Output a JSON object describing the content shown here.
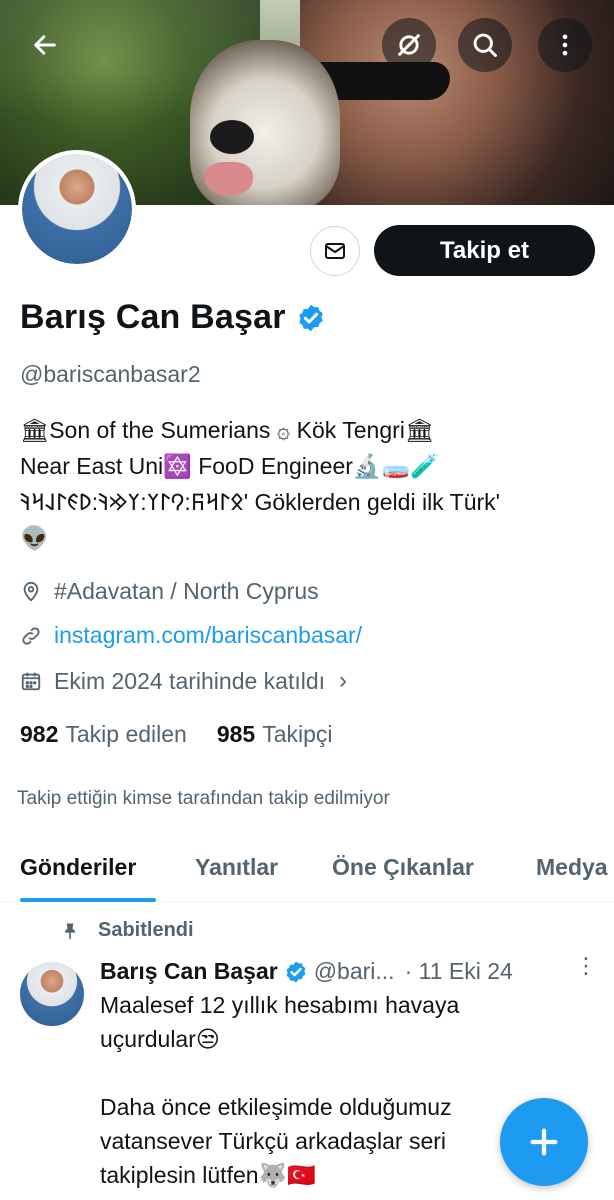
{
  "profile": {
    "name": "Barış Can Başar",
    "handle": "@bariscanbasar2",
    "follow_label": "Takip et",
    "bio": [
      "🏛Son of the Sumerians ۞ Kök Tengri🏛",
      "Near East Uni🔯 FooD Engineer🔬🧫🧪",
      "𐰋𐰃𐰺𐰜:𐰘𐰃𐰠:𐰠𐰢𐰚:𐰖𐰏𐰃𐰞𐰺𐰚' Göklerden geldi ilk Türk'",
      "👽"
    ],
    "location": "#Adavatan / North Cyprus",
    "link": "instagram.com/bariscanbasar/",
    "joined": "Ekim 2024 tarihinde katıldı",
    "following_count": "982",
    "following_label": "Takip edilen",
    "followers_count": "985",
    "followers_label": "Takipçi",
    "not_followed_note": "Takip ettiğin kimse tarafından takip edilmiyor"
  },
  "tabs": [
    {
      "label": "Gönderiler",
      "active": true
    },
    {
      "label": "Yanıtlar",
      "active": false
    },
    {
      "label": "Öne Çıkanlar",
      "active": false
    },
    {
      "label": "Medya",
      "active": false
    }
  ],
  "pinned_tweet": {
    "pinned_label": "Sabitlendi",
    "author_name": "Barış Can Başar",
    "author_handle": "@bari...",
    "date": "· 11 Eki 24",
    "body_lines": [
      "Maalesef 12 yıllık hesabımı havaya",
      "uçurdular😒",
      "",
      "Daha önce etkileşimde olduğumuz",
      "vatansever Türkçü arkadaşlar seri",
      "takiplesin lütfen🐺🇹🇷"
    ]
  },
  "icons": {
    "back": "arrow-left-icon",
    "grok": "grok-icon",
    "search": "search-icon",
    "more": "more-vertical-icon",
    "mail": "mail-icon",
    "location": "location-icon",
    "link": "link-icon",
    "calendar": "calendar-icon",
    "pin": "pin-icon",
    "compose": "plus-icon"
  },
  "colors": {
    "accent": "#1d9bf0",
    "text": "#0f1419",
    "secondary_text": "#536471",
    "follow_button": "#0f1419"
  }
}
